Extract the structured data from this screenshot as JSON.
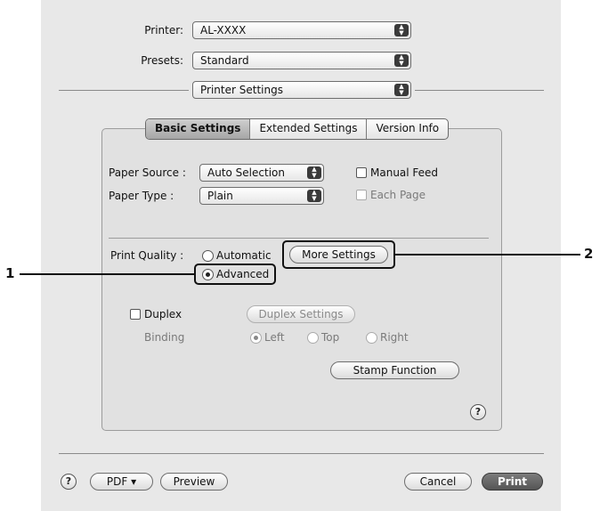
{
  "printer": {
    "label": "Printer:",
    "value": "AL-XXXX"
  },
  "presets": {
    "label": "Presets:",
    "value": "Standard"
  },
  "panel": {
    "value": "Printer Settings"
  },
  "tabs": [
    {
      "label": "Basic Settings",
      "selected": true
    },
    {
      "label": "Extended Settings",
      "selected": false
    },
    {
      "label": "Version Info",
      "selected": false
    }
  ],
  "paper_source": {
    "label": "Paper Source :",
    "value": "Auto Selection"
  },
  "paper_type": {
    "label": "Paper Type :",
    "value": "Plain"
  },
  "manual_feed": {
    "label": "Manual Feed",
    "checked": false
  },
  "each_page": {
    "label": "Each Page",
    "checked": false,
    "enabled": false
  },
  "print_quality": {
    "label": "Print Quality :",
    "automatic_label": "Automatic",
    "advanced_label": "Advanced",
    "selected": "Advanced",
    "more_settings_label": "More Settings"
  },
  "duplex": {
    "label": "Duplex",
    "checked": false,
    "settings_label": "Duplex Settings",
    "binding_label": "Binding",
    "left_label": "Left",
    "top_label": "Top",
    "right_label": "Right",
    "selected": "Left"
  },
  "stamp_function_label": "Stamp Function",
  "footer": {
    "pdf_label": "PDF ▾",
    "preview_label": "Preview",
    "cancel_label": "Cancel",
    "print_label": "Print"
  },
  "callouts": {
    "one": "1",
    "two": "2"
  },
  "icons": {
    "help": "?",
    "popup_arrows": "▲▼"
  }
}
